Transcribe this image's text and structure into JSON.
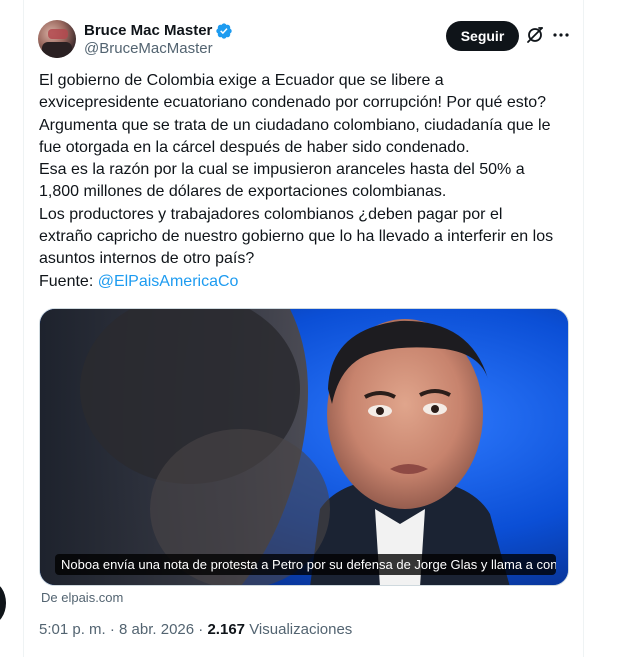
{
  "author": {
    "display_name": "Bruce Mac Master",
    "handle": "@BruceMacMaster",
    "verified": true
  },
  "actions": {
    "follow_label": "Seguir",
    "grok_icon": "grok-icon",
    "more_icon": "more-horizontal-icon"
  },
  "tweet": {
    "lines": [
      "El gobierno de Colombia exige a Ecuador que se libere a",
      "exvicepresidente ecuatoriano condenado por corrupción! Por qué esto?",
      "Argumenta que se trata de un ciudadano colombiano, ciudadanía que le",
      "fue otorgada en la cárcel después de haber sido condenado.",
      "Esa es la razón por la cual se impusieron aranceles hasta del 50% a",
      "1,800 millones de dólares de exportaciones colombianas.",
      "Los productores y trabajadores colombianos ¿deben pagar por el",
      "extraño capricho de nuestro gobierno que lo ha llevado a interferir en los",
      "asuntos internos de otro país?"
    ],
    "source_prefix": "Fuente: ",
    "source_mention": "@ElPaisAmericaCo"
  },
  "media": {
    "caption": "Noboa envía una nota de protesta a Petro por su defensa de Jorge Glas y llama a cons...",
    "source": "De elpais.com"
  },
  "meta": {
    "time": "5:01 p. m.",
    "separator": " · ",
    "date": "8 abr. 2026",
    "views_count": "2.167",
    "views_label": "Visualizaciones"
  },
  "colors": {
    "accent": "#1d9bf0",
    "text": "#0f1419",
    "muted": "#536471",
    "follow_bg": "#0f1419"
  }
}
